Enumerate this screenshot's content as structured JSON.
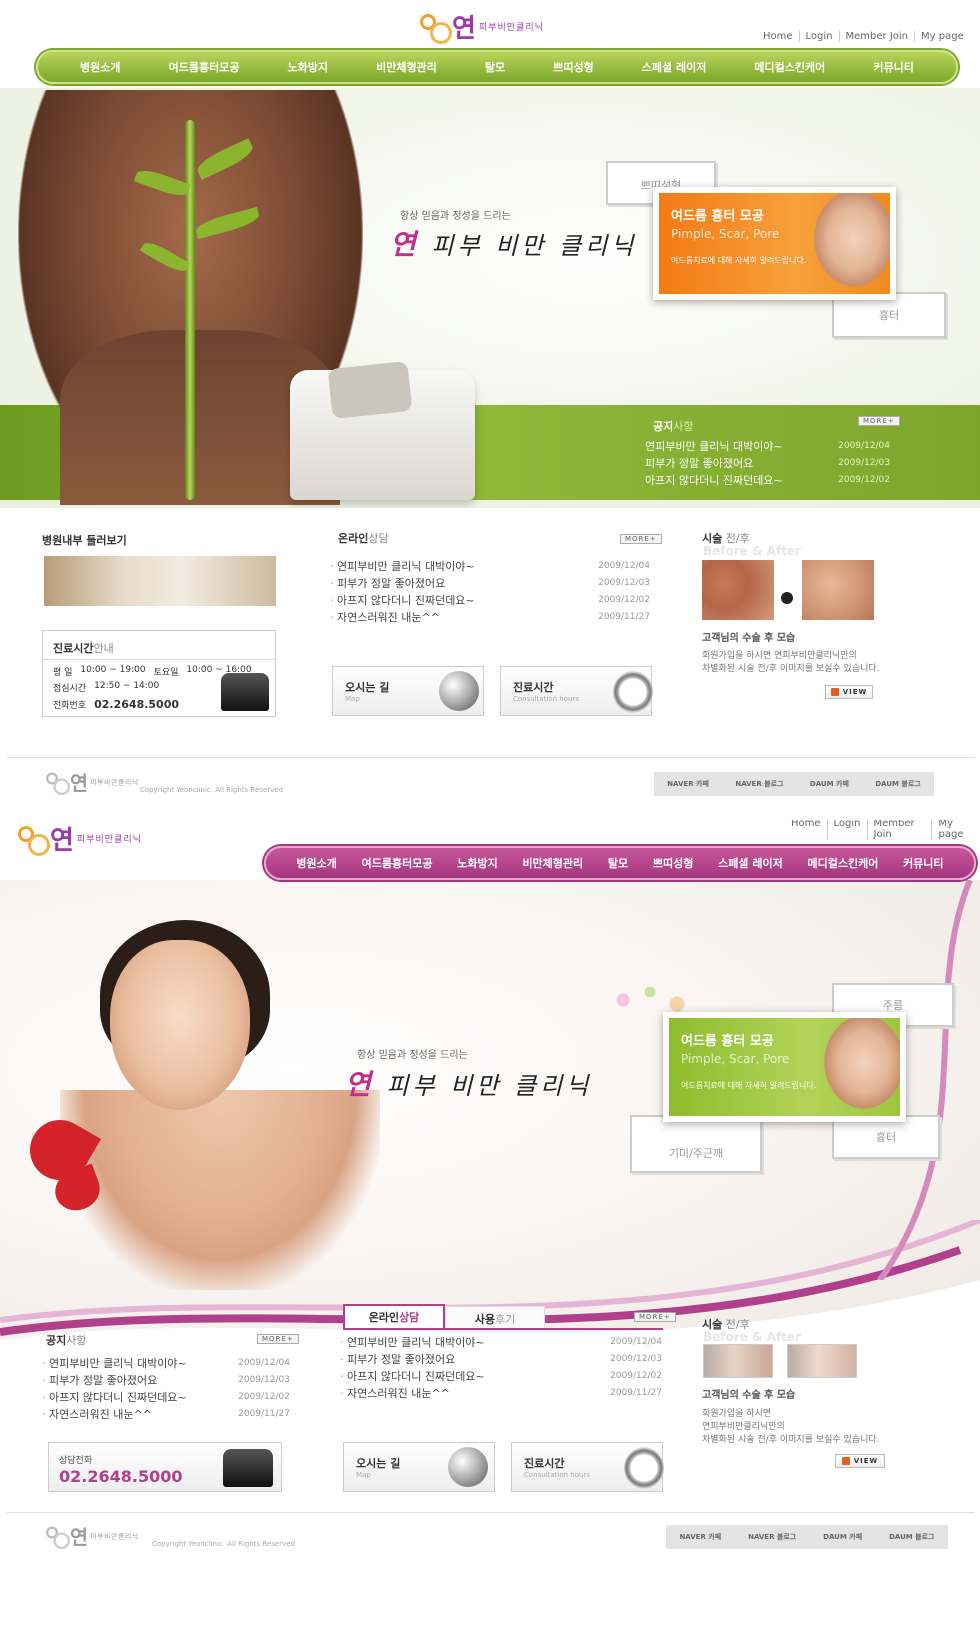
{
  "page1": {
    "logo": {
      "big": "연",
      "small": "피부비만클리닉"
    },
    "toplinks": [
      "Home",
      "Login",
      "Member Join",
      "My page"
    ],
    "nav": [
      "병원소개",
      "여드름흉터모공",
      "노화방지",
      "비만체형관리",
      "탈모",
      "쁘띠성형",
      "스페셜 레이저",
      "메디컬스킨케어",
      "커뮤니티"
    ],
    "slogan_small": "항상 믿음과 정성을 드리는",
    "slogan_y": "연",
    "slogan_rest": "피부 비만 클리닉",
    "tag_top": "쁘띠성형",
    "tag_bottom": "흉터",
    "promo": {
      "title": "여드름 흉터 모공",
      "sub": "Pimple, Scar, Pore",
      "desc": "여드름치료에 대해 자세히 알려드립니다."
    },
    "notice": {
      "title_bold": "공지",
      "title_light": "사항",
      "more": "MORE+",
      "items": [
        {
          "t": "연피부비만 클리닉 대박이야~",
          "d": "2009/12/04"
        },
        {
          "t": "피부가 정말 좋아졌어요",
          "d": "2009/12/03"
        },
        {
          "t": "아프지 않다더니 진짜던데요~",
          "d": "2009/12/02"
        }
      ]
    },
    "tour": {
      "bold": "병원내부",
      "light": " 둘러보기"
    },
    "hours": {
      "title_bold": "진료시간",
      "title_light": "안내",
      "rows": [
        {
          "k": "평     일",
          "v": "10:00 ~ 19:00",
          "k2": "토요일",
          "v2": "10:00 ~ 16:00"
        },
        {
          "k": "점심시간",
          "v": "12:50 ~ 14:00",
          "k2": "",
          "v2": ""
        }
      ],
      "phone_label": "전화번호",
      "phone": "02.2648.5000"
    },
    "consult": {
      "title_bold": "온라인",
      "title_light": "상담",
      "more": "MORE+",
      "items": [
        {
          "t": "연피부비만 클리닉 대박이야~",
          "d": "2009/12/04"
        },
        {
          "t": "피부가 정말 좋아졌어요",
          "d": "2009/12/03"
        },
        {
          "t": "아프지 않다더니 진짜던데요~",
          "d": "2009/12/02"
        },
        {
          "t": "자연스러워진 내눈^^",
          "d": "2009/11/27"
        }
      ]
    },
    "map_btn": {
      "title": "오시는 길",
      "sub": "Map"
    },
    "hours_btn": {
      "title": "진료시간",
      "sub": "Consultation hours"
    },
    "ba": {
      "title_bold": "시술",
      "title_light": " 전/후",
      "en": "Before & After",
      "caption": "고객님의 수술 후 모습",
      "desc1": "회원가입을 하시면  연피부비만클리닉만의",
      "desc2": "차별화된 시술 전/후 이미지를 보실수 있습니다.",
      "view": "VIEW"
    },
    "footer": {
      "copy": "Copyright Yeonclinic. All Rights Reserved",
      "links": [
        "NAVER 카페",
        "NAVER 블로그",
        "DAUM 카페",
        "DAUM 블로그"
      ]
    }
  },
  "page2": {
    "logo": {
      "big": "연",
      "small": "피부비만클리닉"
    },
    "toplinks": [
      "Home",
      "Login",
      "Member Join",
      "My page"
    ],
    "nav": [
      "병원소개",
      "여드름흉터모공",
      "노화방지",
      "비만체형관리",
      "탈모",
      "쁘띠성형",
      "스페셜 레이저",
      "메디컬스킨케어",
      "커뮤니티"
    ],
    "slogan_small": "항상 믿음과 정성을 드리는",
    "slogan_y": "연",
    "slogan_rest": "피부 비만 클리닉",
    "tag_top": "주름",
    "tag_left": "기미/주근깨",
    "tag_bottom": "흉터",
    "promo": {
      "title": "여드름 흉터 모공",
      "sub": "Pimple, Scar, Pore",
      "desc": "여드름치료에 대해 자세히 알려드립니다."
    },
    "notice": {
      "title_bold": "공지",
      "title_light": "사항",
      "more": "MORE+",
      "items": [
        {
          "t": "연피부비만 클리닉 대박이야~",
          "d": "2009/12/04"
        },
        {
          "t": "피부가 정말 좋아졌어요",
          "d": "2009/12/03"
        },
        {
          "t": "아프지 않다더니 진짜던데요~",
          "d": "2009/12/02"
        },
        {
          "t": "자연스러워진 내눈^^",
          "d": "2009/11/27"
        }
      ]
    },
    "phone_box": {
      "label": "상담전화",
      "phone": "02.2648.5000"
    },
    "tabs": {
      "tab1_bold": "온라인",
      "tab1_light": "상담",
      "tab2_bold": "사용",
      "tab2_light": "후기",
      "more": "MORE+",
      "items": [
        {
          "t": "연피부비만 클리닉 대박이야~",
          "d": "2009/12/04"
        },
        {
          "t": "피부가 정말 좋아졌어요",
          "d": "2009/12/03"
        },
        {
          "t": "아프지 않다더니 진짜던데요~",
          "d": "2009/12/02"
        },
        {
          "t": "자연스러워진 내눈^^",
          "d": "2009/11/27"
        }
      ]
    },
    "map_btn": {
      "title": "오시는 길",
      "sub": "Map"
    },
    "hours_btn": {
      "title": "진료시간",
      "sub": "Consultation hours"
    },
    "ba": {
      "title_bold": "시술",
      "title_light": " 전/후",
      "en": "Before & After",
      "caption": "고객님의 수술 후 모습",
      "desc1": "회원가입을 하시면",
      "desc2": "연피부비만클리닉만의",
      "desc3": "차별화된 시술 전/후 이미지를 보실수 있습니다.",
      "view": "VIEW"
    },
    "footer": {
      "copy": "Copyright Yeonclinic. All Rights Reserved",
      "links": [
        "NAVER 카페",
        "NAVER 블로그",
        "DAUM 카페",
        "DAUM 블로그"
      ]
    }
  },
  "colors": {
    "green": "#7ba82a",
    "magenta": "#a33580",
    "orange": "#f08a1e",
    "lime": "#9cc63c"
  }
}
